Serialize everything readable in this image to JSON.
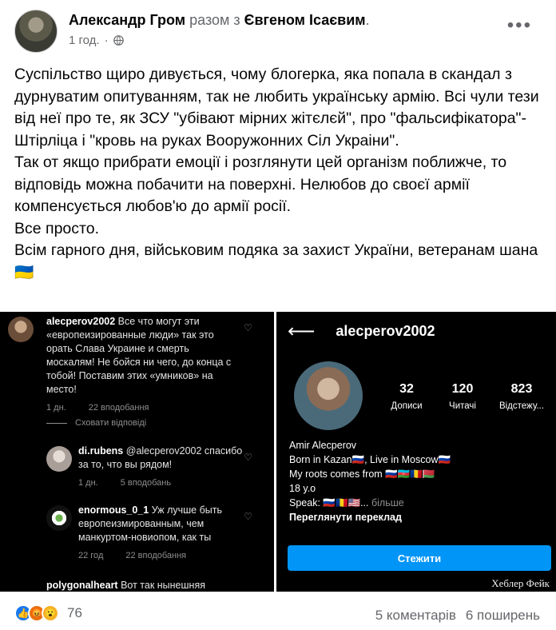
{
  "post": {
    "author": "Александр Гром",
    "with_text": "разом з",
    "tagged": "Євгеном Ісаєвим",
    "time": "1 год.",
    "privacy_icon": "globe-icon",
    "text_lines": [
      "Суспільство щиро дивується, чому блогерка, яка попала в скандал з дурнуватим опитуванням, так не любить українську армію. Всі чули тези від неї про те, як ЗСУ \"убівают мірних жітєлєй\", про \"фальсифікатора\"-Штірліца і \"кровь на руках Вооружонних Сіл Украіни\".",
      "Так от якщо прибрати емоції і розглянути цей організм поближче, то відповідь можна побачити на поверхні. Нелюбов до своєї армії компенсується любов'ю до армії росії.",
      "Все просто.",
      "Всім гарного дня, військовим подяка за захист України, ветеранам шана🇺🇦"
    ]
  },
  "left_image": {
    "comments": [
      {
        "user": "alecperov2002",
        "text": "Все что могут эти «европеизированные люди» так это орать Слава Украине и смерть москалям! Не бойся ни чего, до конца с тобой! Поставим этих «умников» на место!",
        "time": "1 дн.",
        "likes": "22 вподобання"
      },
      {
        "user": "di.rubens",
        "text": "@alecperov2002 спасибо за то, что вы рядом!",
        "time": "1 дн.",
        "likes": "5 вподобань"
      },
      {
        "user": "enormous_0_1",
        "text": "Уж лучше быть европеизмированным, чем манкуртом-новиопом, как ты",
        "time": "22 год",
        "likes": "22 вподобання"
      },
      {
        "user": "polygonalheart",
        "text": "Вот так нынешняя",
        "time": "",
        "likes": ""
      }
    ],
    "hide_replies": "Сховати відповіді"
  },
  "right_image": {
    "username": "alecperov2002",
    "stats": [
      {
        "num": "32",
        "label": "Дописи"
      },
      {
        "num": "120",
        "label": "Читачі"
      },
      {
        "num": "823",
        "label": "Відстежу..."
      }
    ],
    "bio_name": "Amir Alecperov",
    "bio_line1": "Born in Kazan🇷🇺, Live in Moscow🇷🇺",
    "bio_line2": "My roots comes from 🇷🇺🇦🇿🇷🇴🇧🇾",
    "bio_line3": "18 y.o",
    "bio_line4": "Speak: 🇷🇺🇷🇴🇺🇸...",
    "bio_more": "більше",
    "translate": "Переглянути переклад",
    "follow_button": "Стежити",
    "watermark": "Хеблер Фейк"
  },
  "footer": {
    "reactions_count": "76",
    "comments": "5 коментарів",
    "shares": "6 поширень"
  },
  "colors": {
    "ig_blue": "#0095f6",
    "fb_gray": "#65676b"
  }
}
